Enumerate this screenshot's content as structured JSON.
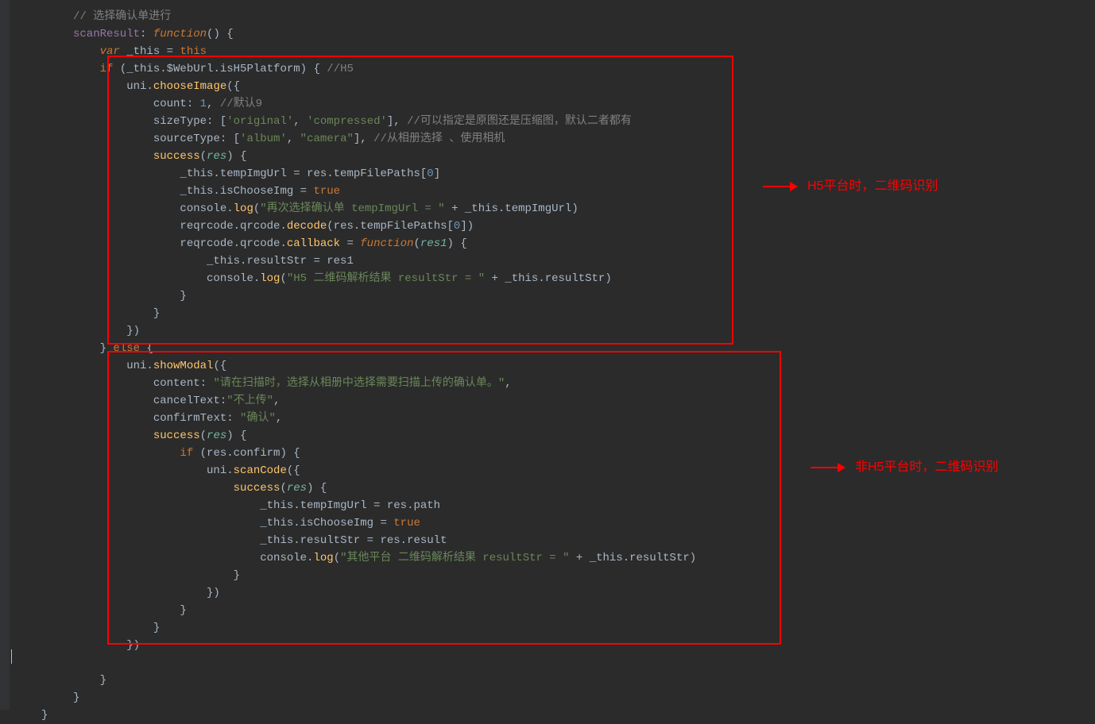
{
  "annotations": {
    "a1": "H5平台时，二维码识别",
    "a2": "非H5平台时，二维码识别"
  },
  "code": {
    "c0": "// 选择确认单进行",
    "c1_a": "scanResult",
    "c1_b": ": ",
    "c1_c": "function",
    "c1_d": "() {",
    "c2_a": "var",
    "c2_b": " _this ",
    "c2_c": "=",
    "c2_d": " this",
    "c3_a": "if",
    "c3_b": " (_this.$WebUrl.isH5Platform) { ",
    "c3_c": "//H5",
    "c4_a": "uni.",
    "c4_b": "chooseImage",
    "c4_c": "({",
    "c5_a": "count: ",
    "c5_b": "1",
    "c5_c": ", ",
    "c5_d": "//默认9",
    "c6_a": "sizeType: [",
    "c6_b": "'original'",
    "c6_c": ", ",
    "c6_d": "'compressed'",
    "c6_e": "], ",
    "c6_f": "//可以指定是原图还是压缩图，默认二者都有",
    "c7_a": "sourceType: [",
    "c7_b": "'album'",
    "c7_c": ", ",
    "c7_d": "\"camera\"",
    "c7_e": "], ",
    "c7_f": "//从相册选择 、使用相机",
    "c8_a": "success",
    "c8_b": "(",
    "c8_c": "res",
    "c8_d": ") {",
    "c9": "_this.tempImgUrl = res.tempFilePaths[",
    "c9_b": "0",
    "c9_c": "]",
    "c10_a": "_this.isChooseImg = ",
    "c10_b": "true",
    "c11_a": "console.",
    "c11_b": "log",
    "c11_c": "(",
    "c11_d": "\"再次选择确认单 tempImgUrl = \"",
    "c11_e": " + _this.tempImgUrl)",
    "c12_a": "reqrcode.qrcode.",
    "c12_b": "decode",
    "c12_c": "(res.tempFilePaths[",
    "c12_d": "0",
    "c12_e": "])",
    "c13_a": "reqrcode.qrcode.",
    "c13_b": "callback",
    "c13_c": " = ",
    "c13_d": "function",
    "c13_e": "(",
    "c13_f": "res1",
    "c13_g": ") {",
    "c14": "_this.resultStr = res1",
    "c15_a": "console.",
    "c15_b": "log",
    "c15_c": "(",
    "c15_d": "\"H5 二维码解析结果 resultStr = \"",
    "c15_e": " + _this.resultStr)",
    "c16": "}",
    "c17": "}",
    "c18": "})",
    "c19_a": "} ",
    "c19_b": "else",
    "c19_c": " {",
    "c20_a": "uni.",
    "c20_b": "showModal",
    "c20_c": "({",
    "c21_a": "content: ",
    "c21_b": "\"请在扫描时，选择从相册中选择需要扫描上传的确认单。\"",
    "c21_c": ",",
    "c22_a": "cancelText:",
    "c22_b": "\"不上传\"",
    "c22_c": ",",
    "c23_a": "confirmText: ",
    "c23_b": "\"确认\"",
    "c23_c": ",",
    "c24_a": "success",
    "c24_b": "(",
    "c24_c": "res",
    "c24_d": ") {",
    "c25_a": "if",
    "c25_b": " (res.confirm) {",
    "c26_a": "uni.",
    "c26_b": "scanCode",
    "c26_c": "({",
    "c27_a": "success",
    "c27_b": "(",
    "c27_c": "res",
    "c27_d": ") {",
    "c28": "_this.tempImgUrl = res.path",
    "c29_a": "_this.isChooseImg = ",
    "c29_b": "true",
    "c30": "_this.resultStr = res.result",
    "c31_a": "console.",
    "c31_b": "log",
    "c31_c": "(",
    "c31_d": "\"其他平台 二维码解析结果 resultStr = \"",
    "c31_e": " + _this.resultStr)",
    "c32": "}",
    "c33": "})",
    "c34": "}",
    "c35": "}",
    "c36": "})",
    "c37": "}",
    "c38": "}",
    "c39": "}"
  }
}
